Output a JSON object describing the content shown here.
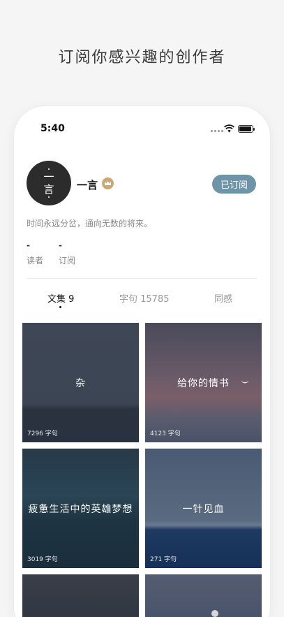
{
  "promo": {
    "headline": "订阅你感兴趣的创作者"
  },
  "status_bar": {
    "time": "5:40"
  },
  "profile": {
    "avatar_text": [
      "一",
      "言"
    ],
    "name": "一言",
    "subscribe_label": "已订阅",
    "bio": "时间永远分岔，通向无数的将来。",
    "stats": [
      {
        "value": "-",
        "label": "读者"
      },
      {
        "value": "-",
        "label": "订阅"
      }
    ]
  },
  "tabs": [
    {
      "label": "文集 9",
      "active": true
    },
    {
      "label": "字句 15785",
      "active": false
    },
    {
      "label": "同感",
      "active": false
    }
  ],
  "collections": [
    {
      "title": "杂",
      "count": "7296 字句"
    },
    {
      "title": "给你的情书",
      "count": "4123 字句"
    },
    {
      "title": "疲惫生活中的英雄梦想",
      "count": "3019 字句"
    },
    {
      "title": "一针见血",
      "count": "271 字句"
    },
    {
      "title": "",
      "count": ""
    },
    {
      "title": "",
      "count": ""
    }
  ],
  "colors": {
    "accent": "#6e94a8",
    "crown": "#c9a875"
  },
  "icons": {
    "crown": "crown-icon",
    "wifi": "wifi-icon",
    "battery": "battery-icon"
  }
}
